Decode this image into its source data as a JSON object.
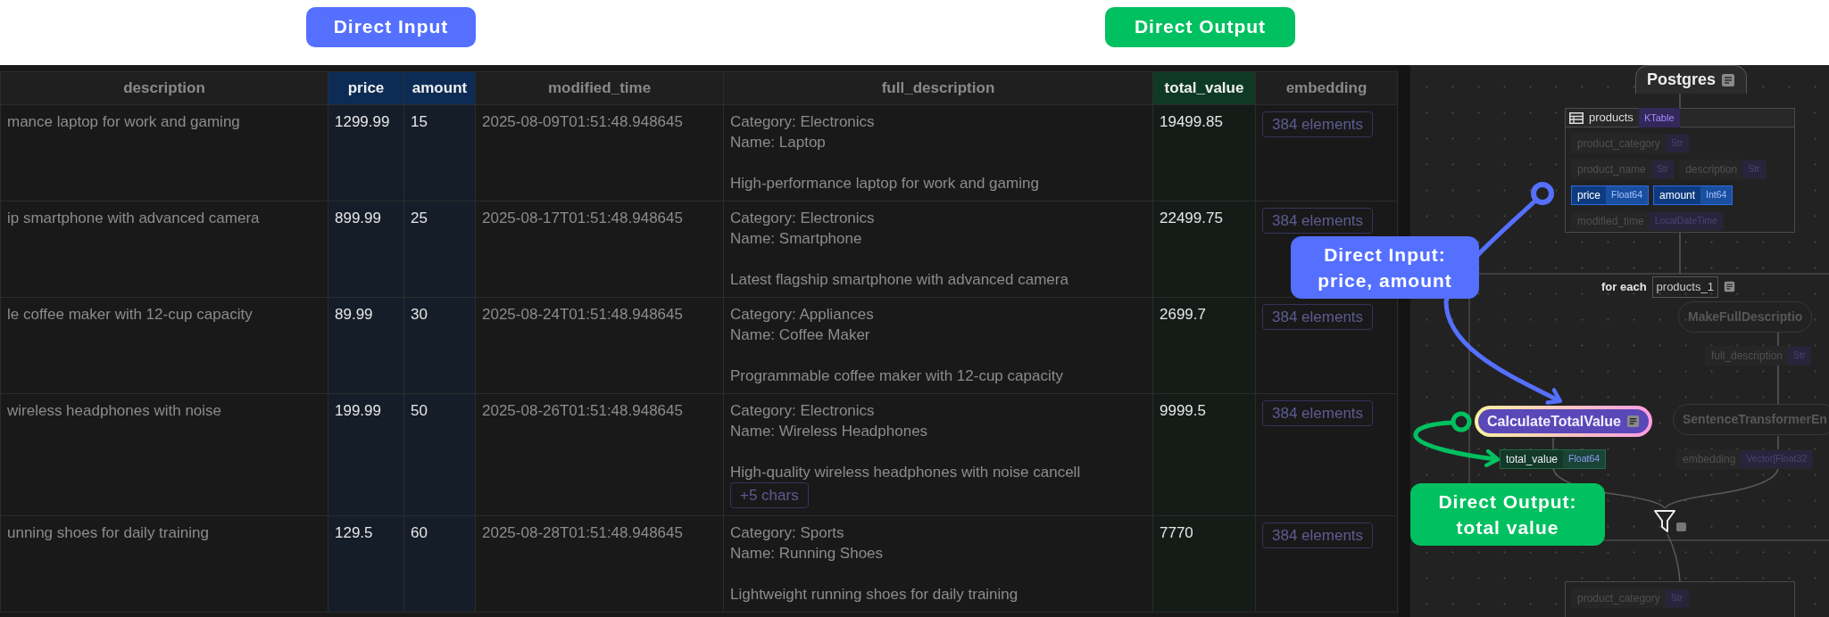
{
  "tags": [
    {
      "kind": "input",
      "text": "Direct Input"
    },
    {
      "kind": "output",
      "text": "Direct Output"
    }
  ],
  "table": {
    "columns": [
      {
        "label": "description",
        "input": false,
        "output": false
      },
      {
        "label": "price",
        "input": true,
        "output": false
      },
      {
        "label": "amount",
        "input": true,
        "output": false
      },
      {
        "label": "modified_time",
        "input": false,
        "output": false
      },
      {
        "label": "full_description",
        "input": false,
        "output": false
      },
      {
        "label": "total_value",
        "input": false,
        "output": true
      },
      {
        "label": "embedding",
        "input": false,
        "output": false
      }
    ],
    "rows": [
      {
        "description": "mance laptop for work and gaming",
        "price": "1299.99",
        "amount": "15",
        "modified_time": "2025-08-09T01:51:48.948645",
        "full_description": {
          "category": "Category: Electronics",
          "name": "Name: Laptop",
          "summary": "High-performance laptop for work and gaming"
        },
        "total_value": "19499.85",
        "embedding": "384 elements"
      },
      {
        "description": "ip smartphone with advanced camera",
        "price": "899.99",
        "amount": "25",
        "modified_time": "2025-08-17T01:51:48.948645",
        "full_description": {
          "category": "Category: Electronics",
          "name": "Name: Smartphone",
          "summary": "Latest flagship smartphone with advanced camera"
        },
        "total_value": "22499.75",
        "embedding": "384 elements"
      },
      {
        "description": "le coffee maker with 12-cup capacity",
        "price": "89.99",
        "amount": "30",
        "modified_time": "2025-08-24T01:51:48.948645",
        "full_description": {
          "category": "Category: Appliances",
          "name": "Name: Coffee Maker",
          "summary": "Programmable coffee maker with 12-cup capacity"
        },
        "total_value": "2699.7",
        "embedding": "384 elements"
      },
      {
        "description": "wireless headphones with noise",
        "price": "199.99",
        "amount": "50",
        "modified_time": "2025-08-26T01:51:48.948645",
        "full_description": {
          "category": "Category: Electronics",
          "name": "Name: Wireless Headphones",
          "summary": "High-quality wireless headphones with noise cancell",
          "more": "+5 chars"
        },
        "total_value": "9999.5",
        "embedding": "384 elements"
      },
      {
        "description": "unning shoes for daily training",
        "price": "129.5",
        "amount": "60",
        "modified_time": "2025-08-28T01:51:48.948645",
        "full_description": {
          "category": "Category: Sports",
          "name": "Name: Running Shoes",
          "summary": "Lightweight running shoes for daily training"
        },
        "total_value": "7770",
        "embedding": "384 elements"
      }
    ]
  },
  "diagram": {
    "source": {
      "label": "Postgres"
    },
    "table": {
      "name": "products",
      "type": "KTable",
      "field_rows": [
        {
          "fields": [
            {
              "name": "product_category",
              "type": "Str",
              "input": false,
              "output": false
            }
          ]
        },
        {
          "fields": [
            {
              "name": "product_name",
              "type": "Str",
              "input": false,
              "output": false
            },
            {
              "name": "description",
              "type": "Str",
              "input": false,
              "output": false
            }
          ]
        },
        {
          "fields": [
            {
              "name": "price",
              "type": "Float64",
              "input": true,
              "output": false
            },
            {
              "name": "amount",
              "type": "Int64",
              "input": true,
              "output": false
            }
          ]
        },
        {
          "fields": [
            {
              "name": "modified_time",
              "type": "LocalDateTime",
              "input": false,
              "output": false
            }
          ]
        }
      ]
    },
    "loop": {
      "label": "for each",
      "collection": "products_1"
    },
    "nodes": [
      {
        "label": "MakeFullDescriptio",
        "active": false
      },
      {
        "label": "CalculateTotalValue",
        "active": true
      },
      {
        "label": "SentenceTransformerEn",
        "active": false
      }
    ],
    "outputs": [
      {
        "name": "full_description",
        "type": "Str",
        "input": false,
        "output": false
      },
      {
        "name": "total_value",
        "type": "Float64",
        "input": false,
        "output": true
      },
      {
        "name": "embedding",
        "type": "Vector[Float32",
        "input": false,
        "output": false
      }
    ],
    "target_fields": [
      {
        "name": "product_category",
        "type": "Str",
        "input": false,
        "output": false
      }
    ]
  },
  "annotations": [
    {
      "kind": "input",
      "text": "Direct Input:\nprice, amount"
    },
    {
      "kind": "output",
      "text": "Direct Output:\ntotal value"
    }
  ]
}
